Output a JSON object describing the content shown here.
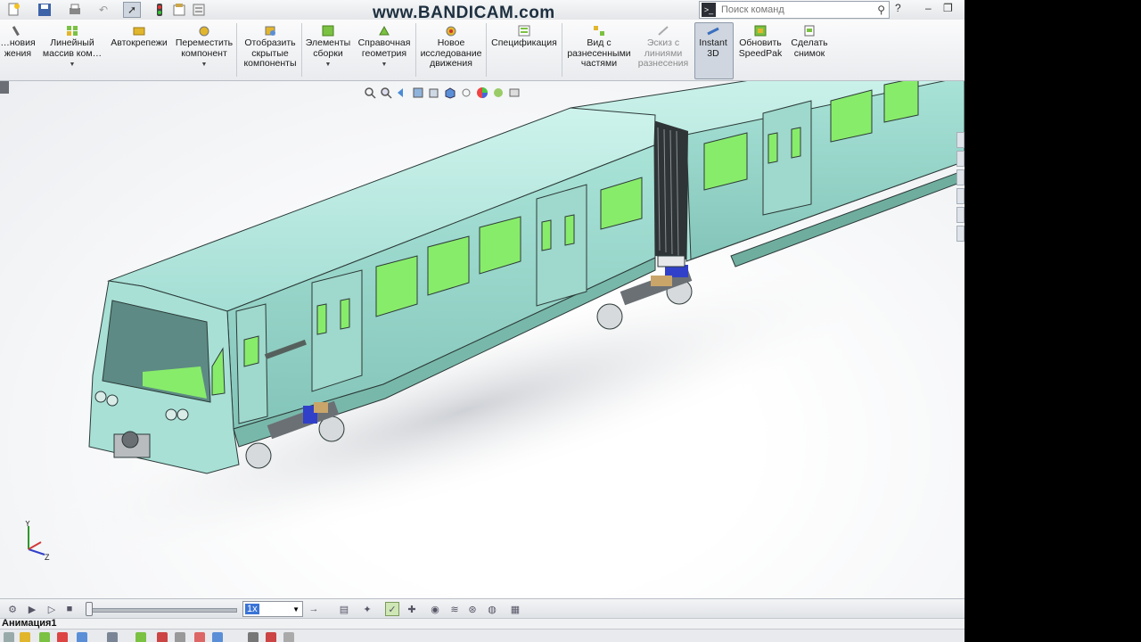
{
  "watermark": "www.BANDICAM.com",
  "search": {
    "placeholder": "Поиск команд"
  },
  "ribbon": {
    "items": [
      {
        "label": "…новия\nжения",
        "disabled": false
      },
      {
        "label": "Линейный\nмассив ком…",
        "disabled": false
      },
      {
        "label": "Автокрепежи",
        "disabled": false
      },
      {
        "label": "Переместить\nкомпонент",
        "disabled": false
      },
      {
        "label": "Отобразить\nскрытые\nкомпоненты",
        "disabled": false
      },
      {
        "label": "Элементы\nсборки",
        "disabled": false
      },
      {
        "label": "Справочная\nгеометрия",
        "disabled": false
      },
      {
        "label": "Новое\nисследование\nдвижения",
        "disabled": false
      },
      {
        "label": "Спецификация",
        "disabled": false
      },
      {
        "label": "Вид с\nразнесенными\nчастями",
        "disabled": false
      },
      {
        "label": "Эскиз с\nлиниями\nразнесения",
        "disabled": true
      },
      {
        "label": "Instant\n3D",
        "disabled": false
      },
      {
        "label": "Обновить\nSpeedPak",
        "disabled": false
      },
      {
        "label": "Сделать\nснимок",
        "disabled": false
      }
    ]
  },
  "motion": {
    "speed": "1x"
  },
  "tabs": {
    "active": "Анимация1"
  },
  "triad": {
    "y": "Y",
    "z": "Z"
  },
  "colors": {
    "body": "#a9e3d8",
    "window": "#86e86a",
    "accent": "#3a74d6"
  }
}
